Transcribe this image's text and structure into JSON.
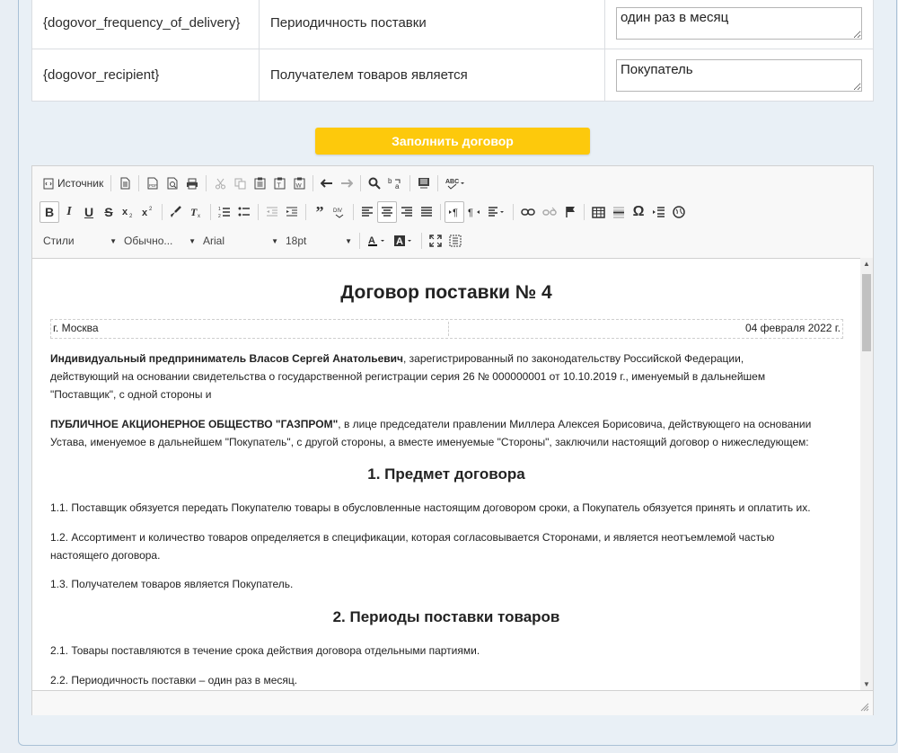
{
  "vars": [
    {
      "code": "{dogovor_frequency_of_delivery}",
      "label": "Периодичность поставки",
      "value": "один раз в месяц"
    },
    {
      "code": "{dogovor_recipient}",
      "label": "Получателем товаров является",
      "value": "Покупатель"
    }
  ],
  "fill_button": "Заполнить договор",
  "toolbar": {
    "source_label": "Источник",
    "styles_label": "Стили",
    "format_label": "Обычно...",
    "font_label": "Arial",
    "size_label": "18pt"
  },
  "doc": {
    "title": "Договор поставки № 4",
    "city": "г. Москва",
    "date": "04 февраля 2022 г.",
    "party1_name": "Индивидуальный предприниматель Власов Сергей Анатольевич",
    "party1_rest_a": ", зарегистрированный по законодательству Российской Федерации,",
    "party1_line2": "действующий на основании свидетельства о государственной регистрации серия 26 № 000000001 от 10.10.2019 г., именуемый в дальнейшем",
    "party1_line3": "\"Поставщик\", с одной стороны и",
    "party2_name": "ПУБЛИЧНОЕ АКЦИОНЕРНОЕ ОБЩЕСТВО \"ГАЗПРОМ\"",
    "party2_rest_a": ", в лице председатели правлении Миллера Алексея Борисовича, действующего на основании",
    "party2_line2": "Устава, именуемое в дальнейшем \"Покупатель\", с другой стороны, а вместе именуемые \"Стороны\", заключили настоящий договор о нижеследующем:",
    "section1": "1. Предмет договора",
    "p1_1": "1.1. Поставщик обязуется передать Покупателю товары в обусловленные настоящим договором сроки, а Покупатель обязуется принять и оплатить их.",
    "p1_2a": "1.2. Ассортимент и количество товаров определяется в спецификации, которая согласовывается Сторонами, и является неотъемлемой частью",
    "p1_2b": "настоящего договора.",
    "p1_3": "1.3. Получателем товаров является Покупатель.",
    "section2": "2. Периоды поставки товаров",
    "p2_1": "2.1. Товары поставляются в течение срока действия договора отдельными партиями.",
    "p2_2": "2.2. Периодичность поставки – один раз в месяц."
  }
}
